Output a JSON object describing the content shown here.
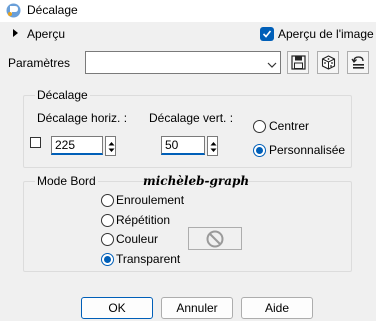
{
  "window": {
    "title": "Décalage",
    "icon": "paint-shop-pro-icon"
  },
  "preview": {
    "label": "Aperçu",
    "expand_icon": "triangle-right-icon"
  },
  "preview_on_image": {
    "label": "Aperçu de l'image",
    "checked": true
  },
  "parameters": {
    "label": "Paramètres",
    "preset_value": "",
    "buttons": [
      "save-preset-icon",
      "randomize-icon",
      "reset-icon"
    ]
  },
  "offset": {
    "title": "Décalage",
    "link_checked": false,
    "horizontal": {
      "label": "Décalage horiz. :",
      "value": "225"
    },
    "vertical": {
      "label": "Décalage vert. :",
      "value": "50"
    },
    "mode": [
      {
        "label": "Centrer",
        "selected": false
      },
      {
        "label": "Personnalisée",
        "selected": true
      }
    ]
  },
  "edge_mode": {
    "title": "Mode Bord",
    "options": [
      {
        "label": "Enroulement",
        "selected": false
      },
      {
        "label": "Répétition",
        "selected": false
      },
      {
        "label": "Couleur",
        "selected": false
      },
      {
        "label": "Transparent",
        "selected": true
      }
    ],
    "color_swatch_icon": "no-color-icon"
  },
  "watermark": "michèleb-graph",
  "buttons": {
    "ok": "OK",
    "cancel": "Annuler",
    "help": "Aide"
  },
  "colors": {
    "accent": "#005fb8",
    "background": "#f0f0f0"
  }
}
